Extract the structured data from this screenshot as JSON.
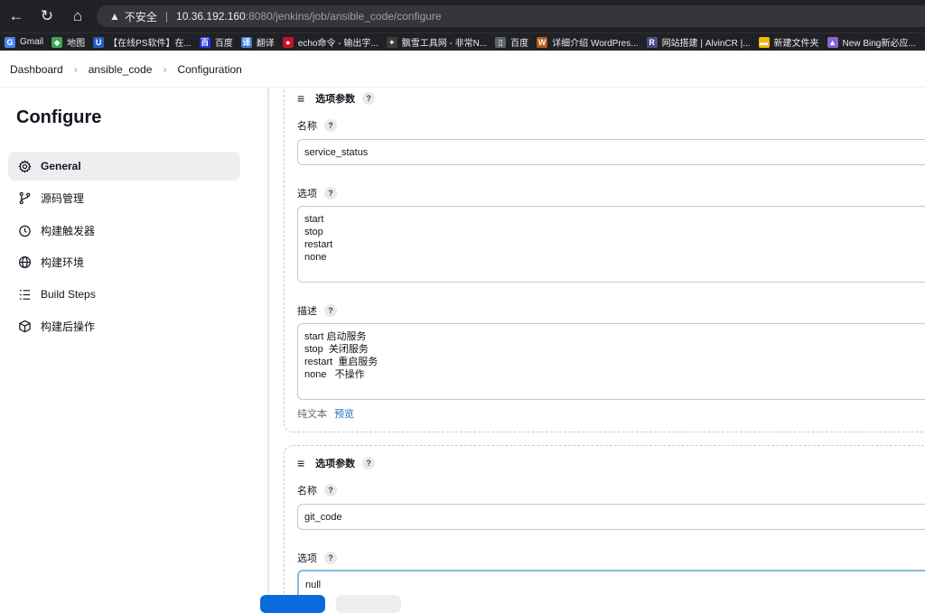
{
  "browser": {
    "security_label": "不安全",
    "url_host": "10.36.192.160",
    "url_path": ":8080/jenkins/job/ansible_code/configure"
  },
  "bookmarks": [
    {
      "label": "Gmail",
      "icon": "google-icon",
      "color": "#4285f4",
      "glyph": "G"
    },
    {
      "label": "地图",
      "icon": "maps-icon",
      "color": "#34a853",
      "glyph": "◆"
    },
    {
      "label": "【在线PS软件】在...",
      "icon": "ps-icon",
      "color": "#1f5fbf",
      "glyph": "U"
    },
    {
      "label": "百度",
      "icon": "baidu-icon",
      "color": "#2932e1",
      "glyph": "百"
    },
    {
      "label": "翻译",
      "icon": "translate-icon",
      "color": "#3a7bd5",
      "glyph": "译"
    },
    {
      "label": "echo命令 - 输出字...",
      "icon": "echo-icon",
      "color": "#c8102e",
      "glyph": "●"
    },
    {
      "label": "飘雪工具网 - 非常N...",
      "icon": "tool-icon",
      "color": "#3c3c3c",
      "glyph": "✦"
    },
    {
      "label": "百度",
      "icon": "page-icon",
      "color": "#5f6368",
      "glyph": "▯"
    },
    {
      "label": "详细介绍 WordPres...",
      "icon": "wordpress-icon",
      "color": "#b35a1f",
      "glyph": "W"
    },
    {
      "label": "网站搭建 | AlvinCR |...",
      "icon": "site-icon",
      "color": "#4a4a8a",
      "glyph": "R"
    },
    {
      "label": "新建文件夹",
      "icon": "folder-icon",
      "color": "#f2b807",
      "glyph": "▬"
    },
    {
      "label": "New Bing新必应...",
      "icon": "bing-icon",
      "color": "#8a63d2",
      "glyph": "▲"
    }
  ],
  "breadcrumb": {
    "items": [
      "Dashboard",
      "ansible_code",
      "Configuration"
    ]
  },
  "sidebar": {
    "title": "Configure",
    "items": [
      {
        "label": "General",
        "icon": "gear-icon",
        "active": true
      },
      {
        "label": "源码管理",
        "icon": "branch-icon",
        "active": false
      },
      {
        "label": "构建触发器",
        "icon": "timer-icon",
        "active": false
      },
      {
        "label": "构建环境",
        "icon": "globe-icon",
        "active": false
      },
      {
        "label": "Build Steps",
        "icon": "list-icon",
        "active": false
      },
      {
        "label": "构建后操作",
        "icon": "package-icon",
        "active": false
      }
    ]
  },
  "params": [
    {
      "title": "选项参数",
      "name_label": "名称",
      "name_value": "service_status",
      "choices_label": "选项",
      "choices_value": "start\nstop\nrestart\nnone",
      "desc_label": "描述",
      "desc_value": "start 启动服务\nstop  关闭服务\nrestart  重启服务\nnone   不操作",
      "plain_text": "纯文本",
      "preview": "预览"
    },
    {
      "title": "选项参数",
      "name_label": "名称",
      "name_value": "git_code",
      "choices_label": "选项",
      "choices_value": "null"
    }
  ],
  "help_glyph": "?",
  "colors": {
    "primary_button": "#0b6bde",
    "link": "#1a6fc8",
    "active_nav_bg": "#eeeef1"
  }
}
